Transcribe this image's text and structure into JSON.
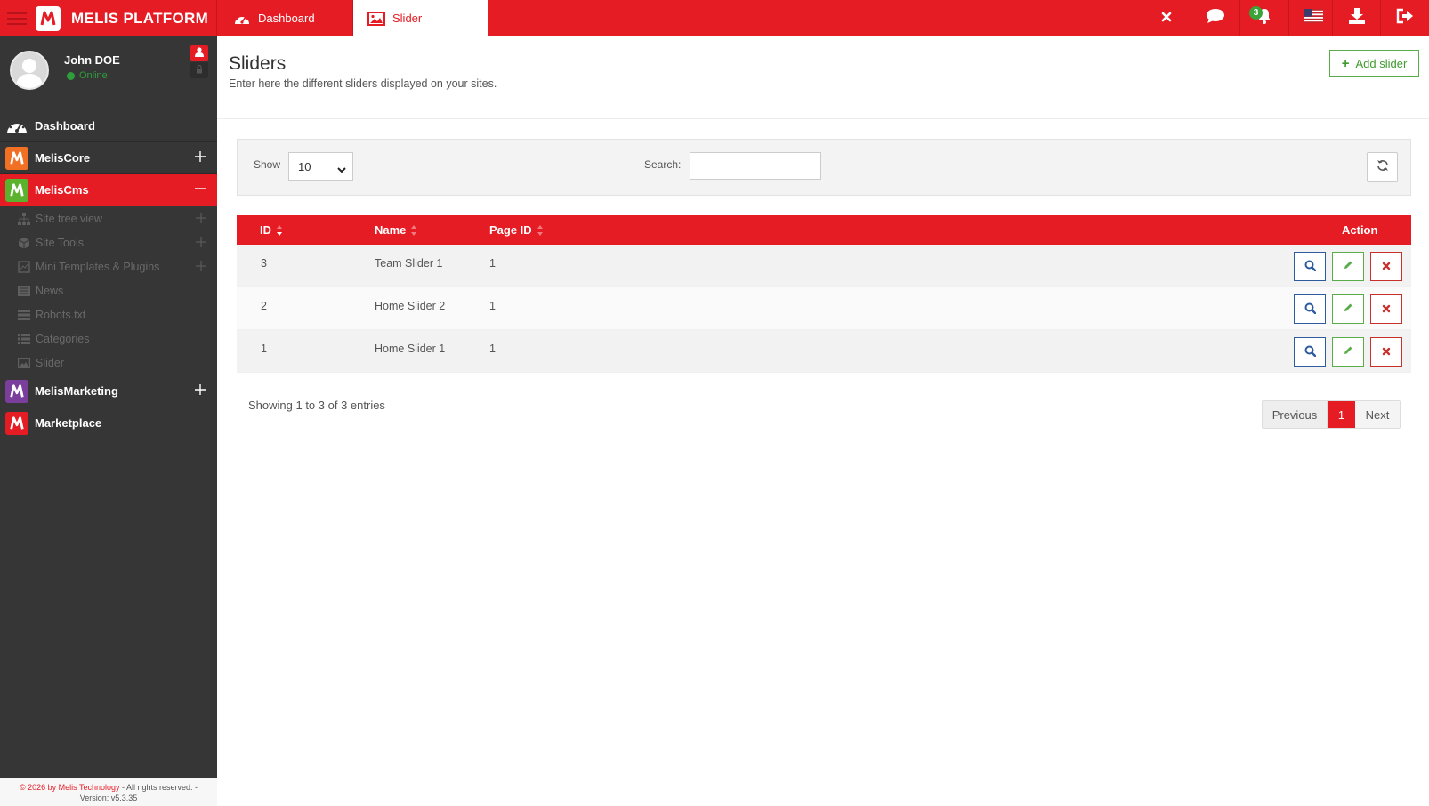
{
  "brand": {
    "name": "MELIS PLATFORM"
  },
  "tabs": [
    {
      "label": "Dashboard"
    },
    {
      "label": "Slider"
    }
  ],
  "topbar": {
    "notification_count": "3"
  },
  "user": {
    "name": "John DOE",
    "status": "Online"
  },
  "menu": {
    "dashboard": "Dashboard",
    "meliscore": "MelisCore",
    "meliscms": "MelisCms",
    "cms_items": [
      "Site tree view",
      "Site Tools",
      "Mini Templates & Plugins",
      "News",
      "Robots.txt",
      "Categories",
      "Slider"
    ],
    "melismarketing": "MelisMarketing",
    "marketplace": "Marketplace"
  },
  "footer": {
    "copyright": "© 2026 by Melis Technology",
    "rights": " - All rights reserved. -",
    "version": "Version: v5.3.35"
  },
  "page": {
    "title": "Sliders",
    "description": "Enter here the different sliders displayed on your sites.",
    "add_label": "Add slider"
  },
  "filters": {
    "show_label": "Show",
    "show_value": "10",
    "search_label": "Search:",
    "search_value": ""
  },
  "table": {
    "headers": {
      "id": "ID",
      "name": "Name",
      "page_id": "Page ID",
      "action": "Action"
    },
    "rows": [
      {
        "id": "3",
        "name": "Team Slider 1",
        "page_id": "1"
      },
      {
        "id": "2",
        "name": "Home Slider 2",
        "page_id": "1"
      },
      {
        "id": "1",
        "name": "Home Slider 1",
        "page_id": "1"
      }
    ]
  },
  "pagination": {
    "info": "Showing 1 to 3 of 3 entries",
    "prev": "Previous",
    "current": "1",
    "next": "Next"
  },
  "colors": {
    "brand_red": "#e61c24",
    "sidebar": "#363636",
    "success": "#5aab4a",
    "primary": "#2d5c9e",
    "danger": "#c9302c",
    "meliscore": "#f27024",
    "meliscms": "#5ab22d",
    "melismarketing": "#7a3e9d"
  }
}
